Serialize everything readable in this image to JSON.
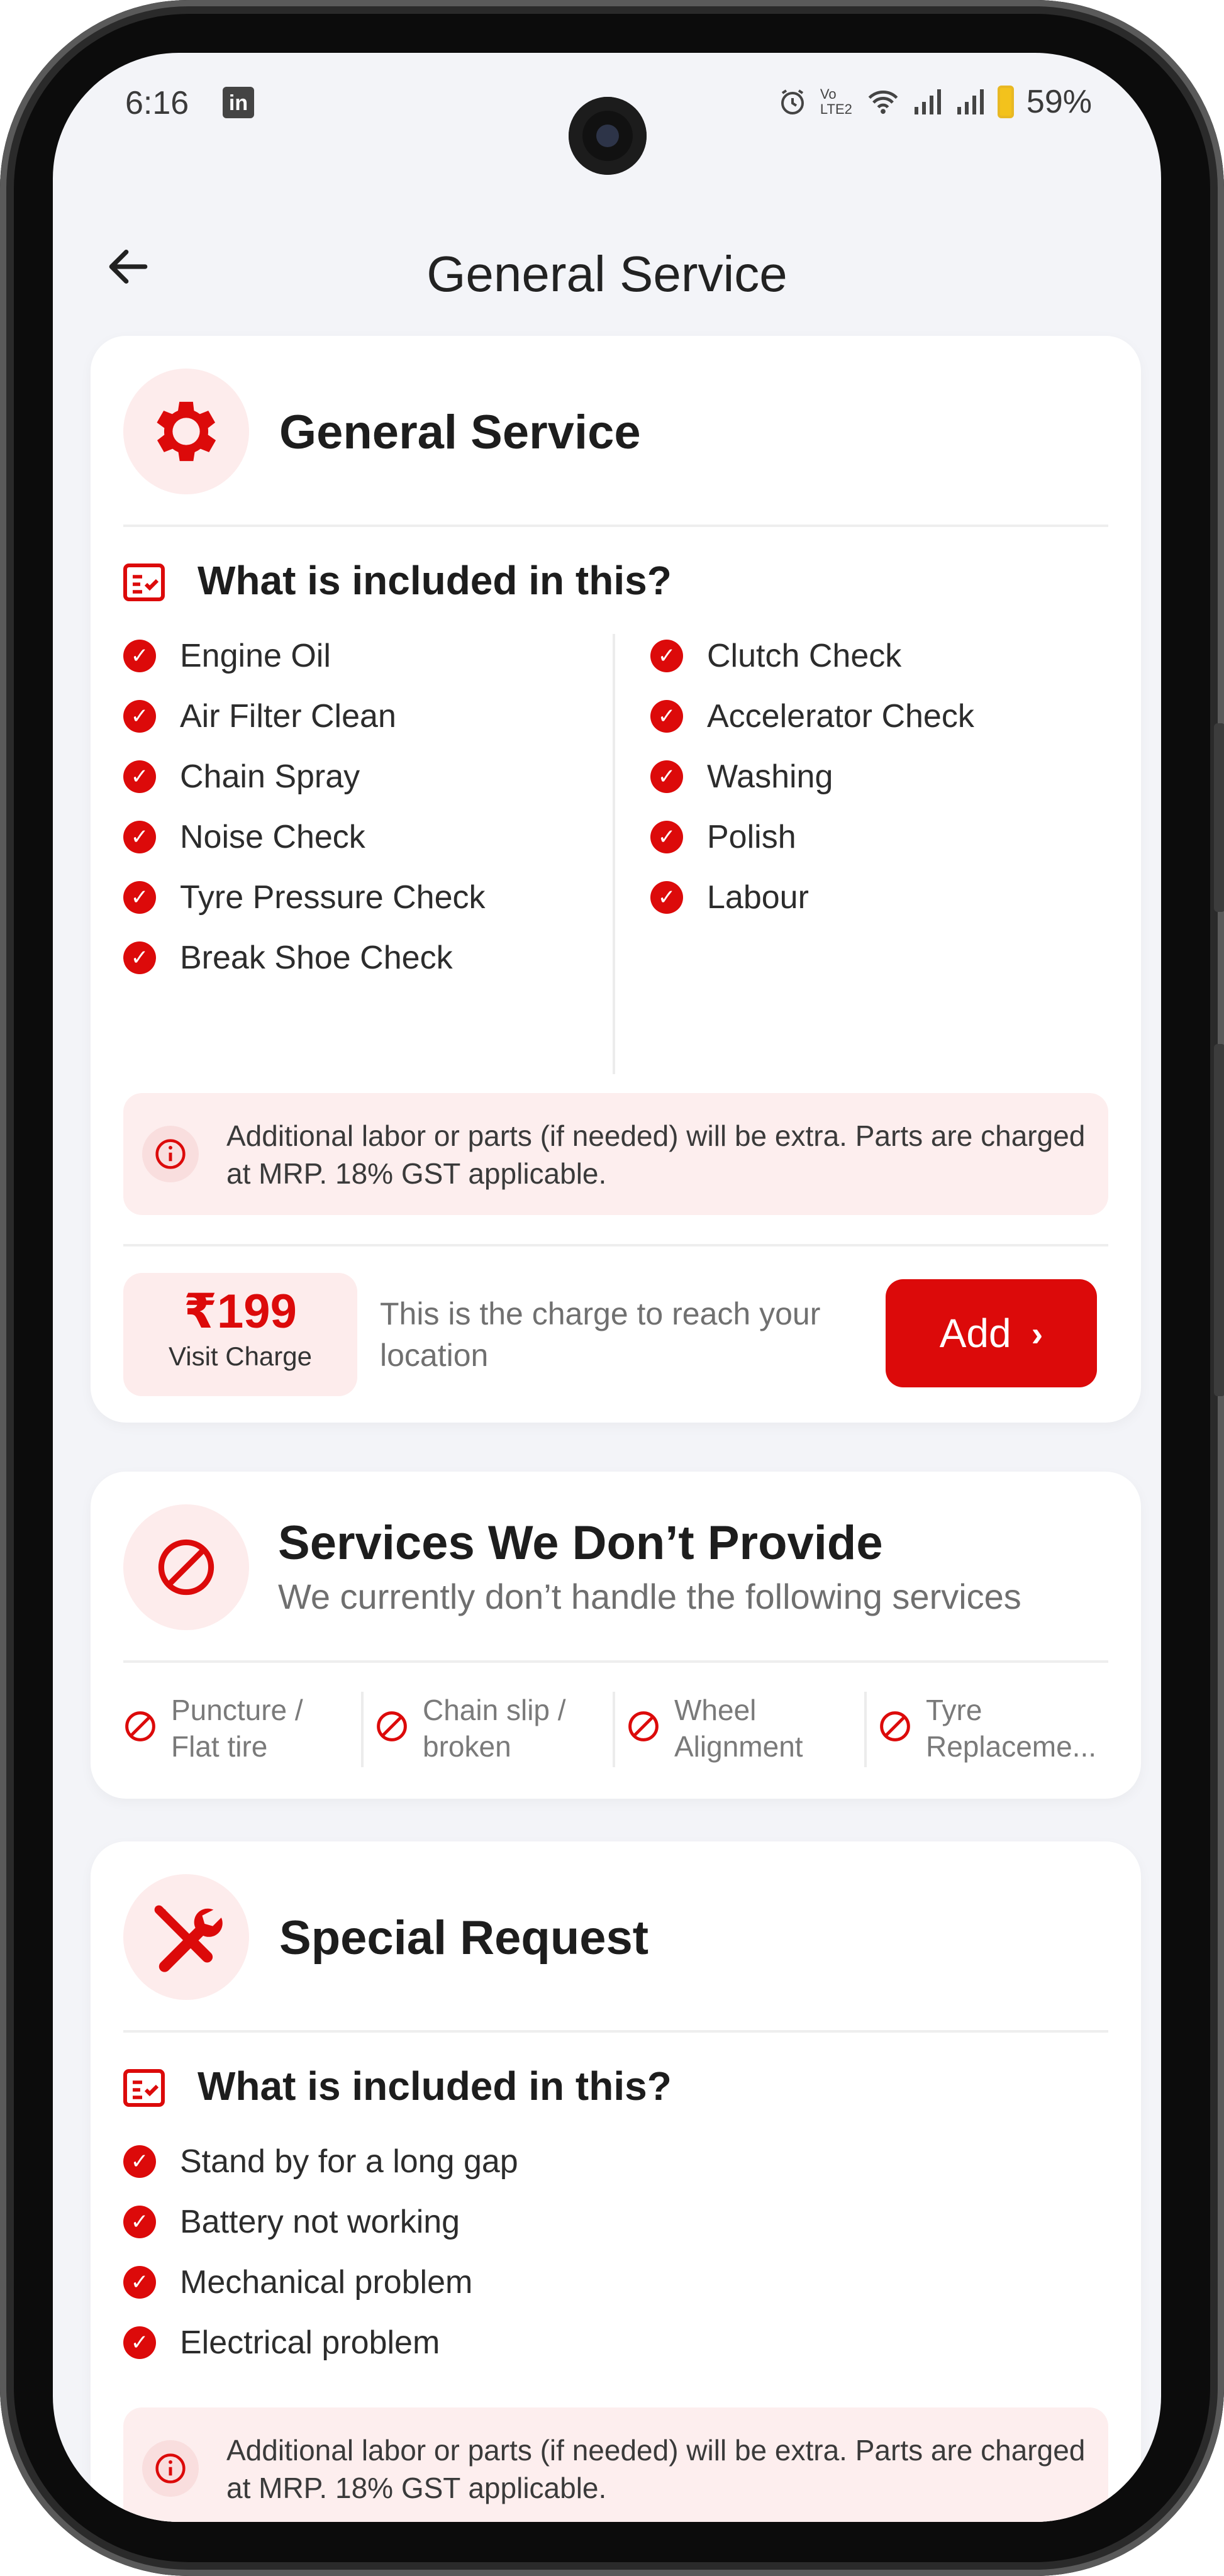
{
  "status_bar": {
    "time": "6:16",
    "app_icon": "in",
    "indicators": [
      "alarm-icon",
      "volte-icon",
      "wifi-icon",
      "signal-icon",
      "signal-icon",
      "battery-icon"
    ],
    "volte": "Vo LTE2",
    "battery": "59%"
  },
  "header": {
    "title": "General Service",
    "back_icon": "arrow-left-icon"
  },
  "general_service": {
    "title": "General Service",
    "icon": "gear-icon",
    "included_heading": "What is included in this?",
    "items_left": [
      "Engine Oil",
      "Air Filter Clean",
      "Chain Spray",
      "Noise Check",
      "Tyre Pressure Check",
      "Break Shoe Check"
    ],
    "items_right": [
      "Clutch Check",
      "Accelerator Check",
      "Washing",
      "Polish",
      "Labour"
    ],
    "note": "Additional labor or parts (if needed) will be extra. Parts are charged at MRP. 18% GST applicable.",
    "price": "₹199",
    "price_label": "Visit Charge",
    "charge_desc": "This is the charge to reach your location",
    "add_label": "Add"
  },
  "not_provided": {
    "title": "Services We Don’t Provide",
    "subtitle": "We currently don’t handle the following services",
    "icon": "ban-icon",
    "items": [
      {
        "line1": "Puncture /",
        "line2": "Flat tire"
      },
      {
        "line1": "Chain slip /",
        "line2": "broken"
      },
      {
        "line1": "Wheel",
        "line2": "Alignment"
      },
      {
        "line1": "Tyre",
        "line2": "Replaceme..."
      }
    ]
  },
  "special_request": {
    "title": "Special Request",
    "icon": "tools-icon",
    "included_heading": "What is included in this?",
    "items": [
      "Stand by for a long gap",
      "Battery not working",
      "Mechanical problem",
      "Electrical problem"
    ],
    "note": "Additional labor or parts (if needed) will be extra. Parts are charged at MRP. 18% GST applicable."
  },
  "colors": {
    "accent": "#dc0a0a",
    "accent_light": "#fdecec",
    "background": "#f3f4f8"
  }
}
